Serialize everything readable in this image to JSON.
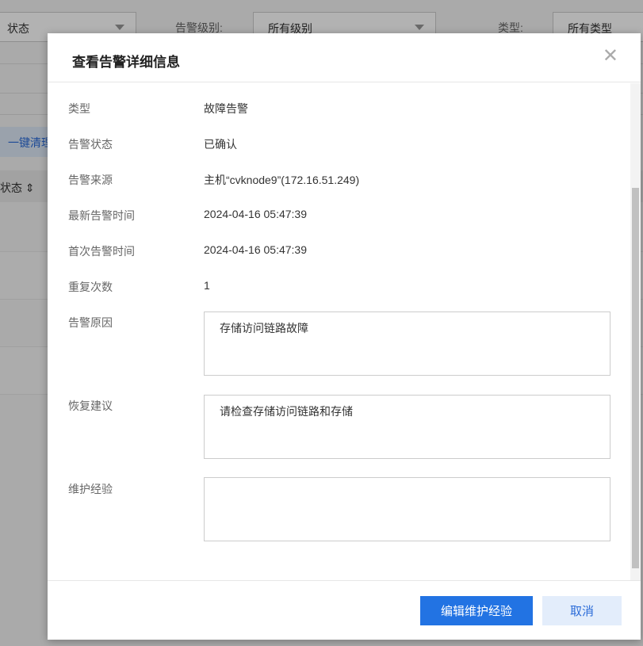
{
  "background": {
    "status_select": "状态",
    "level_label": "告警级别:",
    "level_select": "所有级别",
    "type_label": "类型:",
    "type_select": "所有类型",
    "clear_button": "一键清理",
    "status_column": "状态"
  },
  "modal": {
    "title": "查看告警详细信息",
    "fields": [
      {
        "label": "类型",
        "value": "故障告警"
      },
      {
        "label": "告警状态",
        "value": "已确认"
      },
      {
        "label": "告警来源",
        "value": "主机“cvknode9”(172.16.51.249)"
      },
      {
        "label": "最新告警时间",
        "value": "2024-04-16 05:47:39"
      },
      {
        "label": "首次告警时间",
        "value": "2024-04-16 05:47:39"
      },
      {
        "label": "重复次数",
        "value": "1"
      }
    ],
    "cause_label": "告警原因",
    "cause_value": "存储访问链路故障",
    "suggest_label": "恢复建议",
    "suggest_value": "请检查存储访问链路和存储",
    "experience_label": "维护经验",
    "experience_value": "",
    "edit_button": "编辑维护经验",
    "cancel_button": "取消"
  }
}
